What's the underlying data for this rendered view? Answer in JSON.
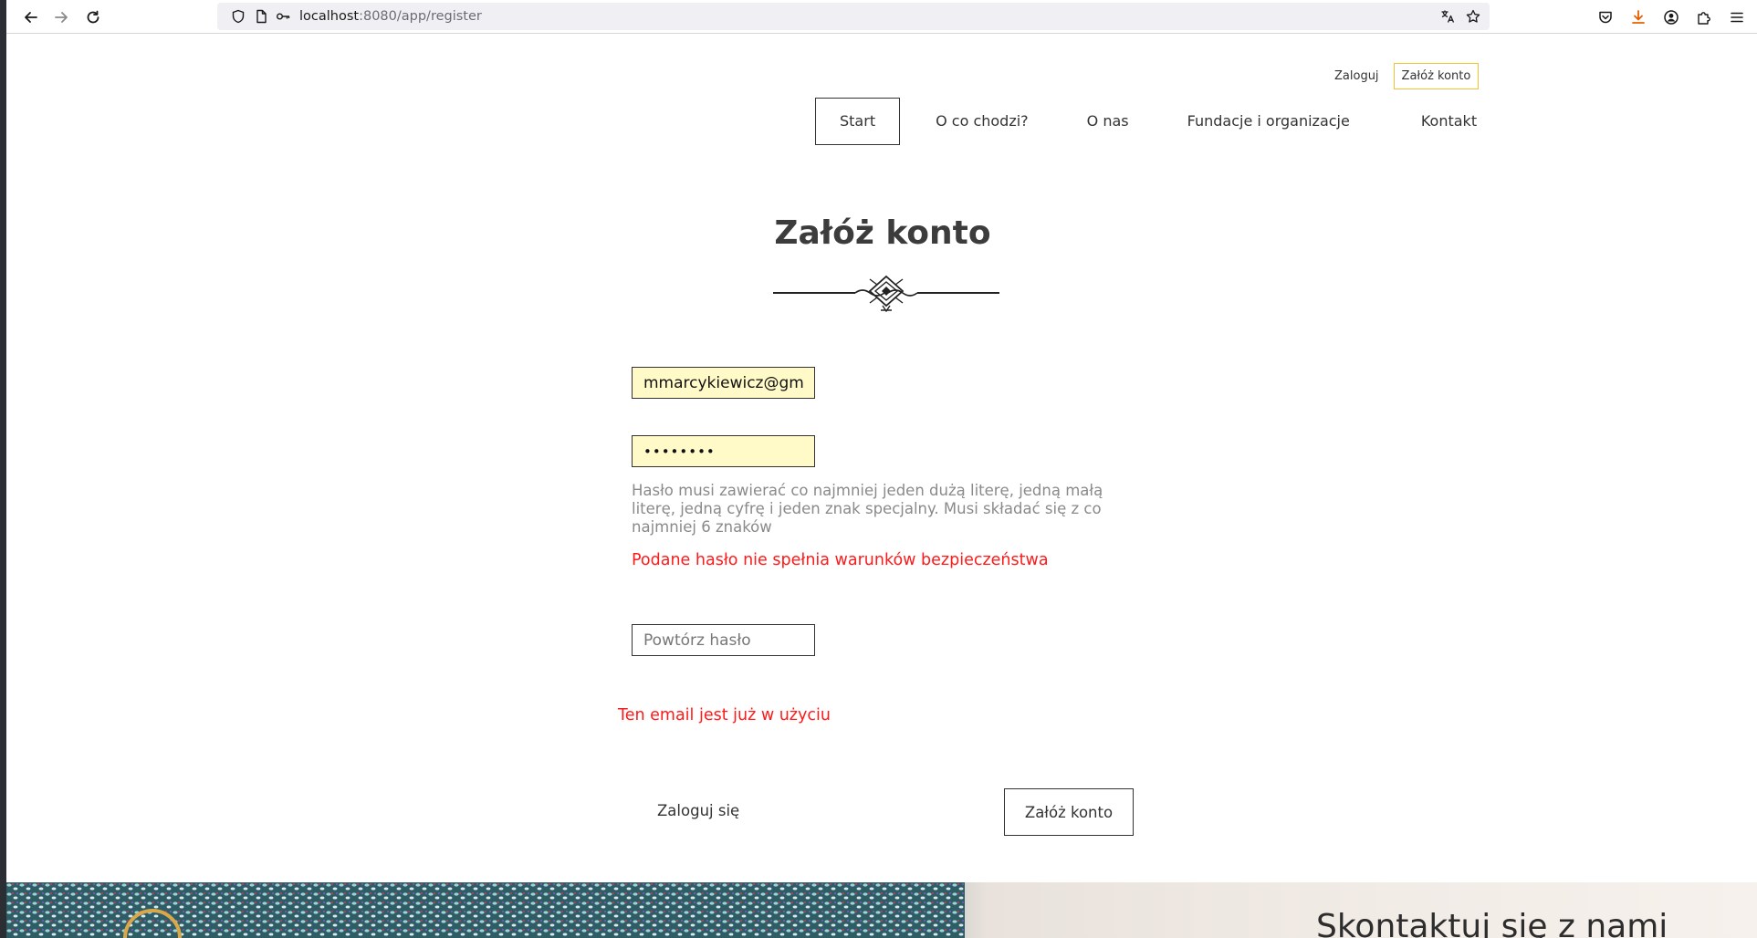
{
  "browser": {
    "url_host": "localhost",
    "url_rest": ":8080/app/register"
  },
  "header": {
    "login_link": "Zaloguj",
    "register_button": "Załóż konto"
  },
  "nav": {
    "items": [
      "Start",
      "O co chodzi?",
      "O nas",
      "Fundacje i organizacje",
      "Kontakt"
    ],
    "active": "Start"
  },
  "form": {
    "title": "Załóż konto",
    "email_value": "mmarcykiewicz@gm",
    "password_value": "••••••••",
    "password_hint": "Hasło musi zawierać co najmniej jeden dużą literę, jedną małą literę, jedną cyfrę i jeden znak specjalny. Musi składać się z co najmniej 6 znaków",
    "password_error": "Podane hasło nie spełnia warunków bezpieczeństwa",
    "repeat_placeholder": "Powtórz hasło",
    "email_error": "Ten email jest już w użyciu",
    "login_link": "Zaloguj się",
    "submit_label": "Załóż konto"
  },
  "footer": {
    "contact_title": "Skontaktuj się z nami"
  },
  "colors": {
    "autofill_bg": "#fffac8",
    "error": "#ff1a1a",
    "accent_border": "#f1c232"
  }
}
